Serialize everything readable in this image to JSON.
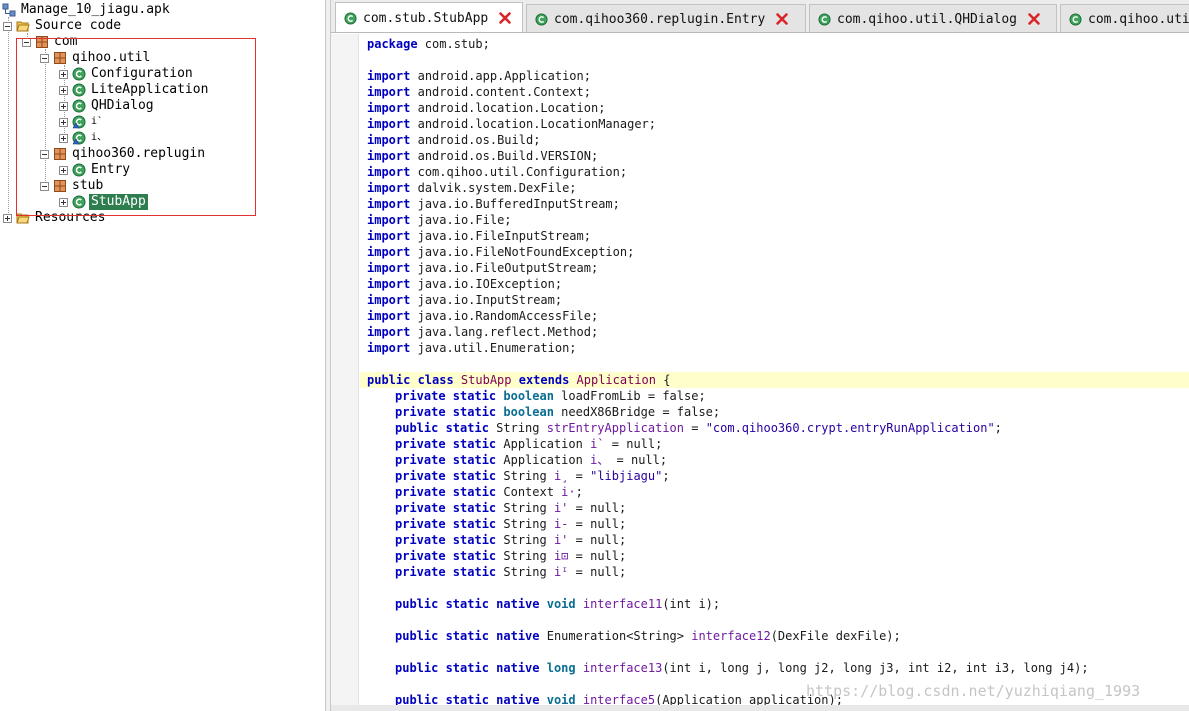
{
  "tree": {
    "root": "Manage_10_jiagu.apk",
    "source_code": "Source code",
    "com": "com",
    "qihoo_util": "qihoo.util",
    "configuration": "Configuration",
    "lite_application": "LiteApplication",
    "qhdialog": "QHDialog",
    "obf_class_1": "i`",
    "obf_class_2": "i、",
    "qihoo360_replugin": "qihoo360.replugin",
    "entry": "Entry",
    "stub": "stub",
    "stubapp": "StubApp",
    "resources": "Resources"
  },
  "tabs": [
    {
      "label": "com.stub.StubApp",
      "active": true
    },
    {
      "label": "com.qihoo360.replugin.Entry",
      "active": false
    },
    {
      "label": "com.qihoo.util.QHDialog",
      "active": false
    },
    {
      "label": "com.qihoo.uti",
      "active": false
    }
  ],
  "code": {
    "l_pkg": [
      "package",
      " com.stub;"
    ],
    "imports": [
      "android.app.Application;",
      "android.content.Context;",
      "android.location.Location;",
      "android.location.LocationManager;",
      "android.os.Build;",
      "android.os.Build.VERSION;",
      "com.qihoo.util.Configuration;",
      "dalvik.system.DexFile;",
      "java.io.BufferedInputStream;",
      "java.io.File;",
      "java.io.FileInputStream;",
      "java.io.FileNotFoundException;",
      "java.io.FileOutputStream;",
      "java.io.IOException;",
      "java.io.InputStream;",
      "java.io.RandomAccessFile;",
      "java.lang.reflect.Method;",
      "java.util.Enumeration;"
    ],
    "import_kw": "import",
    "class_decl": {
      "mods": "public class",
      "name": " StubApp ",
      "extends": "extends",
      "parent": " Application ",
      "brace": "{"
    },
    "fields": [
      {
        "mods": "private static",
        "type": " boolean",
        "rest": " loadFromLib = false;"
      },
      {
        "mods": "private static",
        "type": " boolean",
        "rest": " needX86Bridge = false;"
      },
      {
        "mods": "public static",
        "type": " String",
        "name": " strEntryApplication",
        "rest": " = ",
        "str": "\"com.qihoo360.crypt.entryRunApplication\"",
        "end": ";"
      },
      {
        "mods": "private static",
        "type": " Application",
        "name": " i`",
        "rest": " = null;"
      },
      {
        "mods": "private static",
        "type": " Application",
        "name": " i、",
        "rest": " = null;"
      },
      {
        "mods": "private static",
        "type": " String",
        "name": " i¸",
        "rest": " = ",
        "str": "\"libjiagu\"",
        "end": ";"
      },
      {
        "mods": "private static",
        "type": " Context",
        "name": " i·",
        "rest": ";"
      },
      {
        "mods": "private static",
        "type": " String",
        "name": " i'",
        "rest": " = null;"
      },
      {
        "mods": "private static",
        "type": " String",
        "name": " i-",
        "rest": " = null;"
      },
      {
        "mods": "private static",
        "type": " String",
        "name": " i'",
        "rest": " = null;"
      },
      {
        "mods": "private static",
        "type": " String",
        "name": " i⊡",
        "rest": " = null;"
      },
      {
        "mods": "private static",
        "type": " String",
        "name": " iᴵ",
        "rest": " = null;"
      }
    ],
    "methods": [
      {
        "mods": "public static native",
        "ret": " void",
        "name": " interface11",
        "params": "(int i);"
      },
      {
        "mods": "public static native",
        "ret": " Enumeration<String>",
        "name": " interface12",
        "params": "(DexFile dexFile);"
      },
      {
        "mods": "public static native",
        "ret": " long",
        "name": " interface13",
        "params": "(int i, long j, long j2, long j3, int i2, int i3, long j4);"
      },
      {
        "mods": "public static native",
        "ret": " void",
        "name": " interface5",
        "params": "(Application application);"
      }
    ]
  },
  "watermark": "https://blog.csdn.net/yuzhiqiang_1993",
  "colors": {
    "selection": "#2e7d4f",
    "highlight_box": "#e0322e",
    "current_line": "#ffffcc",
    "close_x": "#d9262b"
  }
}
